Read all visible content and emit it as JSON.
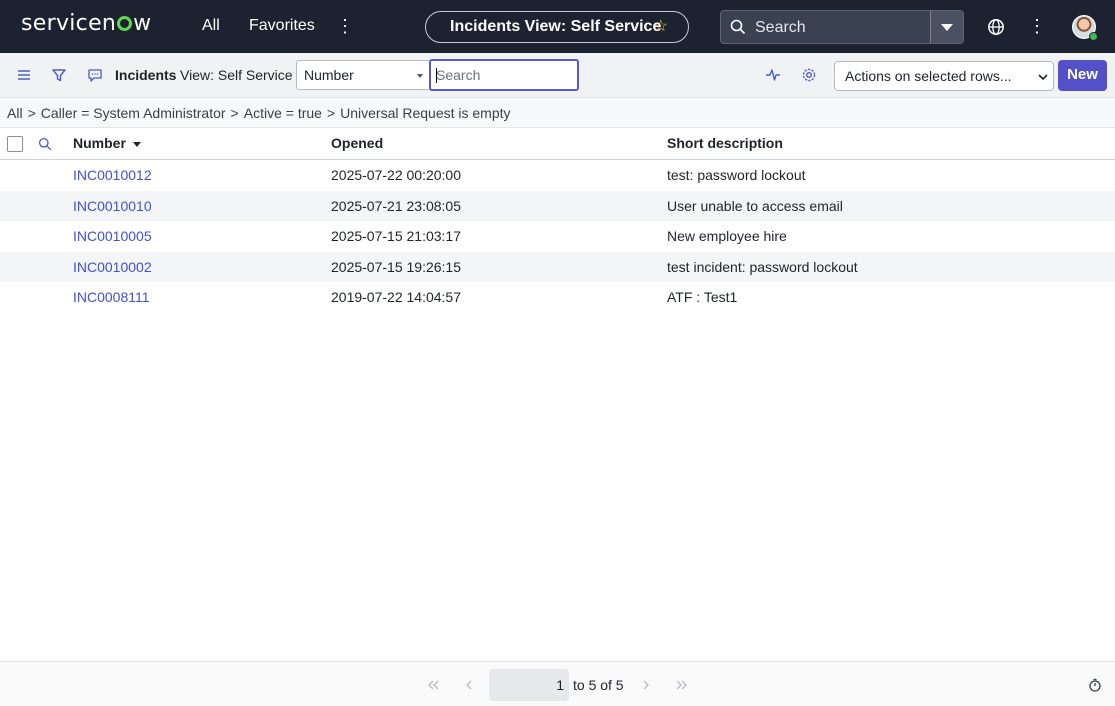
{
  "header": {
    "logo_text": "servicenow",
    "nav_all": "All",
    "nav_favorites": "Favorites",
    "context_pill": "Incidents View: Self Service",
    "global_search_placeholder": "Search",
    "icons": [
      "more-vertical-icon",
      "star-icon",
      "search-icon",
      "chevron-down-icon",
      "globe-icon",
      "avatar"
    ]
  },
  "toolbar": {
    "list_title": "Incidents",
    "view_label": "View: Self Service",
    "search_field": "Number",
    "search_placeholder": "Search",
    "actions_select": "Actions on selected rows...",
    "new_label": "New",
    "accent_color": "#5450c7"
  },
  "breadcrumb": {
    "items": [
      "All",
      "Caller = System Administrator",
      "Active = true",
      "Universal Request is empty"
    ],
    "separator": ">"
  },
  "table": {
    "columns": [
      "Number",
      "Opened",
      "Short description"
    ],
    "sorted_column": "Number",
    "rows": [
      {
        "number": "INC0010012",
        "opened": "2025-07-22 00:20:00",
        "short_description": "test: password lockout"
      },
      {
        "number": "INC0010010",
        "opened": "2025-07-21 23:08:05",
        "short_description": "User unable to access email"
      },
      {
        "number": "INC0010005",
        "opened": "2025-07-15 21:03:17",
        "short_description": "New employee hire"
      },
      {
        "number": "INC0010002",
        "opened": "2025-07-15 19:26:15",
        "short_description": "test incident: password lockout"
      },
      {
        "number": "INC0008111",
        "opened": "2019-07-22 14:04:57",
        "short_description": "ATF : Test1"
      }
    ]
  },
  "pagination": {
    "current": "1",
    "range_text": "to 5 of 5"
  }
}
